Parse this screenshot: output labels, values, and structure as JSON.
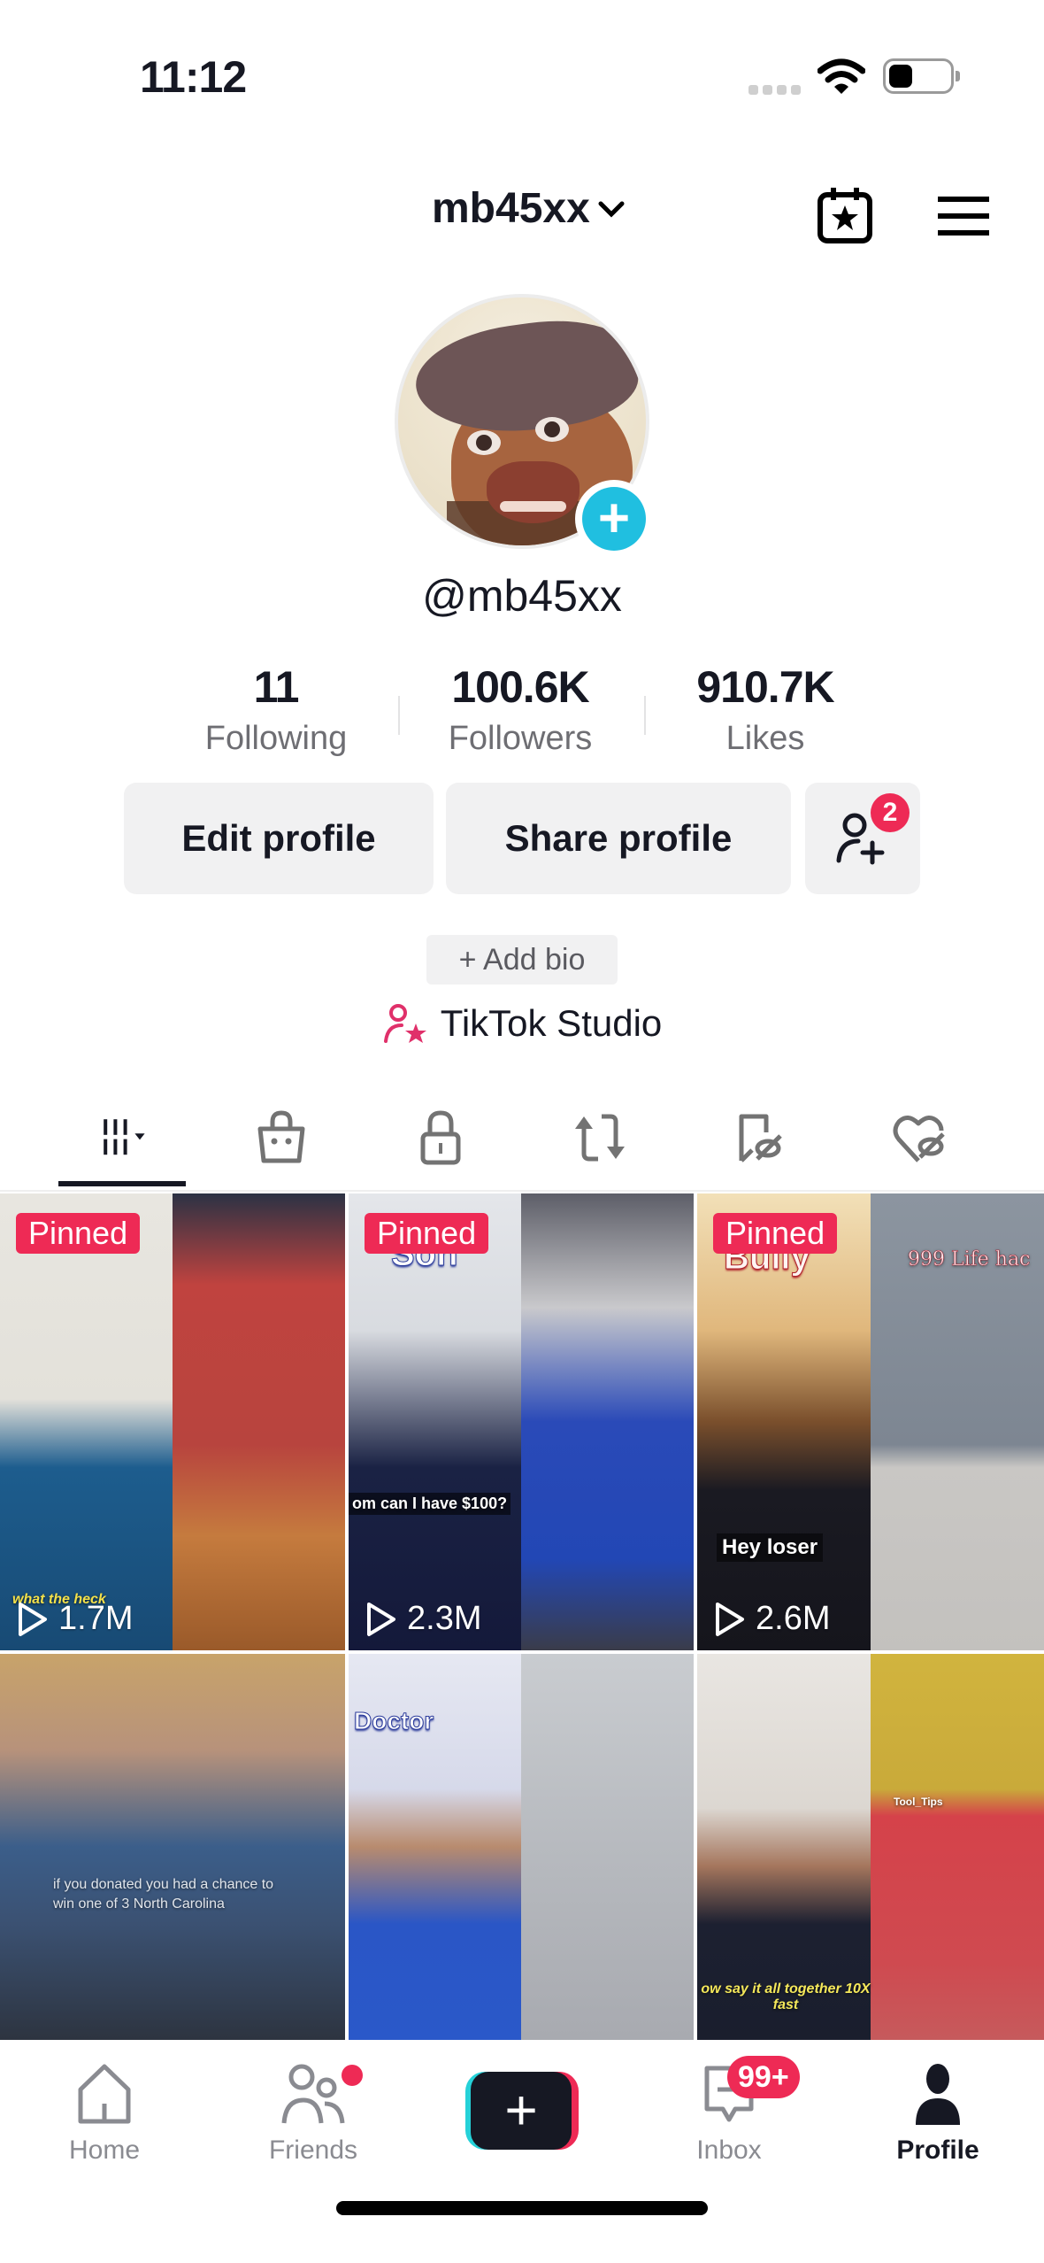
{
  "status_bar": {
    "time": "11:12"
  },
  "header": {
    "username": "mb45xx",
    "calendar_icon": "calendar-star-icon",
    "menu_icon": "hamburger-menu-icon"
  },
  "profile": {
    "handle": "@mb45xx",
    "stats": [
      {
        "value": "11",
        "label": "Following"
      },
      {
        "value": "100.6K",
        "label": "Followers"
      },
      {
        "value": "910.7K",
        "label": "Likes"
      }
    ],
    "buttons": {
      "edit": "Edit profile",
      "share": "Share profile",
      "friend_requests_badge": "2"
    },
    "add_bio": "+ Add bio",
    "studio": "TikTok Studio"
  },
  "content_tabs": [
    {
      "name": "videos",
      "icon": "grid-icon",
      "active": true
    },
    {
      "name": "shop",
      "icon": "shopping-bag-icon"
    },
    {
      "name": "private",
      "icon": "lock-icon"
    },
    {
      "name": "reposts",
      "icon": "repost-icon"
    },
    {
      "name": "favorites",
      "icon": "bookmark-hidden-icon"
    },
    {
      "name": "liked",
      "icon": "heart-hidden-icon"
    }
  ],
  "videos": [
    {
      "pinned": "Pinned",
      "views": "1.7M",
      "caption": "what the heck"
    },
    {
      "pinned": "Pinned",
      "views": "2.3M",
      "title": "Son",
      "caption": "om can I have $100?"
    },
    {
      "pinned": "Pinned",
      "views": "2.6M",
      "title": "Bully",
      "caption": "Hey loser",
      "side_caption": "999 Life hac"
    },
    {
      "caption": "if you donated you had a chance to win one of 3 North Carolina"
    },
    {
      "title": "Doctor"
    },
    {
      "caption": "ow say it all together 10X fast",
      "side_caption": "Tool_Tips"
    }
  ],
  "bottom_nav": {
    "items": [
      {
        "label": "Home"
      },
      {
        "label": "Friends"
      },
      {
        "label": "Inbox",
        "badge": "99+"
      },
      {
        "label": "Profile",
        "active": true
      }
    ]
  },
  "colors": {
    "accent": "#ee2a55",
    "cyan": "#25d1d8",
    "avatar_add": "#20bfe0"
  }
}
